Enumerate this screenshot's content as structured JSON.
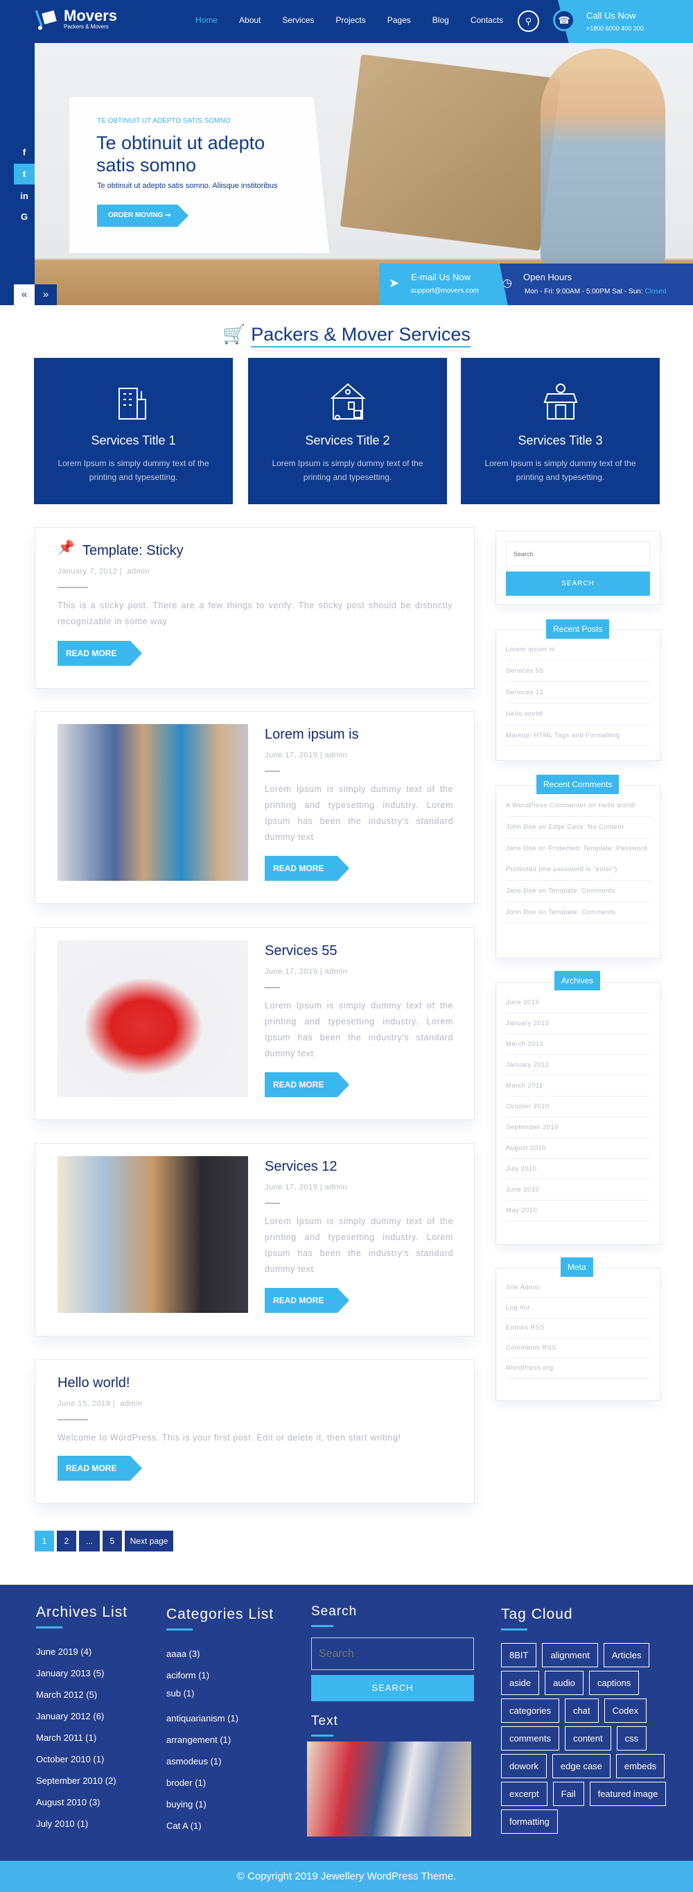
{
  "colors": {
    "navy": "#0d3a8c",
    "cyan": "#3bb7ee",
    "footer": "#233e8c"
  },
  "header": {
    "logo_title": "Movers",
    "logo_subtitle": "Packers & Movers",
    "nav": [
      "Home",
      "About",
      "Services",
      "Projects",
      "Pages",
      "Blog",
      "Contacts"
    ],
    "active_nav": "Home",
    "call_label": "Call Us Now",
    "call_number": "+1800 6000 400 200",
    "icons": [
      "search-icon",
      "phone-icon"
    ]
  },
  "hero": {
    "kicker": "TE OBTINUIT UT ADEPTO SATIS SOMNO",
    "title": "Te obtinuit ut adepto satis somno",
    "subtitle": "Te obtinuit ut adepto satis somno. Aliisque institoribus",
    "button": "ORDER MOVING ➞",
    "social": [
      "facebook-icon",
      "twitter-icon",
      "linkedin-icon",
      "google-icon"
    ],
    "email_label": "E-mail Us Now",
    "email": "support@movers.com",
    "hours_label": "Open Hours",
    "hours": "Mon - Fri: 9:00AM - 5:00PM Sat - Sun: ",
    "hours_closed": "Closed"
  },
  "services": {
    "title": "Packers & Mover Services",
    "items": [
      {
        "title": "Services Title 1",
        "text": "Lorem Ipsum is simply dummy text of the  printing and typesetting.",
        "icon": "building-icon"
      },
      {
        "title": "Services Title 2",
        "text": "Lorem Ipsum is simply dummy text of the  printing and typesetting.",
        "icon": "house-truck-icon"
      },
      {
        "title": "Services Title 3",
        "text": "Lorem Ipsum is simply dummy text of the  printing and typesetting.",
        "icon": "shop-icon"
      }
    ]
  },
  "posts": [
    {
      "title": "Template: Sticky",
      "date": "January 7, 2012",
      "author": "admin",
      "text": "This is a sticky post. There are a few things to verify: The sticky post should be distinctly recognizable in some way",
      "read_more": "READ MORE"
    },
    {
      "title": "Lorem ipsum is",
      "date": "June 17, 2019",
      "author": "admin",
      "text": "Lorem Ipsum is simply dummy text of the printing and typesetting industry. Lorem Ipsum has been the industry's standard dummy text",
      "read_more": "READ MORE"
    },
    {
      "title": "Services 55",
      "date": "June 17, 2019",
      "author": "admin",
      "text": "Lorem Ipsum is simply dummy text of the printing and typesetting industry. Lorem Ipsum has been the industry's standard dummy text",
      "read_more": "READ MORE"
    },
    {
      "title": "Services 12",
      "date": "June 17, 2019",
      "author": "admin",
      "text": "Lorem Ipsum is simply dummy text of the printing and typesetting industry. Lorem Ipsum has been the industry's standard dummy text",
      "read_more": "READ MORE"
    },
    {
      "title": "Hello world!",
      "date": "June 15, 2019",
      "author": "admin",
      "text": "Welcome to WordPress. This is your first post. Edit or delete it, then start writing!",
      "read_more": "READ MORE"
    }
  ],
  "pagination": {
    "pages": [
      "1",
      "2",
      "...",
      "5"
    ],
    "current": "1",
    "next": "Next page"
  },
  "sidebar": {
    "search_placeholder": "Search",
    "search_button": "SEARCH",
    "recent_posts": {
      "title": "Recent Posts",
      "items": [
        "Lorem ipsum is",
        "Services 55",
        "Services 12",
        "Hello world!",
        "Markup: HTML Tags and Formatting"
      ]
    },
    "recent_comments": {
      "title": "Recent Comments",
      "items": [
        "A WordPress Commenter on Hello world!",
        "John Doe on Edge Case: No Content",
        "Jane Doe on Protected: Template: Password Protected (the password is \"enter\")",
        "Jane Doe on Template: Comments",
        "John Doe on Template: Comments"
      ]
    },
    "archives": {
      "title": "Archives",
      "items": [
        "June 2019",
        "January 2013",
        "March 2012",
        "January 2012",
        "March 2011",
        "October 2010",
        "September 2010",
        "August 2010",
        "July 2010",
        "June 2010",
        "May 2010"
      ]
    },
    "meta": {
      "title": "Meta",
      "items": [
        "Site Admin",
        "Log out",
        "Entries RSS",
        "Comments RSS",
        "WordPress.org"
      ]
    }
  },
  "footer": {
    "archives_title": "Archives List",
    "archives": [
      "June 2019 (4)",
      "January 2013 (5)",
      "March 2012 (5)",
      "January 2012 (6)",
      "March 2011 (1)",
      "October 2010 (1)",
      "September 2010 (2)",
      "August 2010 (3)",
      "July 2010 (1)"
    ],
    "categories_title": "Categories List",
    "categories": [
      "aaaa (3)",
      "aciform (1)",
      "sub (1)",
      "antiquarianism (1)",
      "arrangement (1)",
      "asmodeus (1)",
      "broder (1)",
      "buying (1)",
      "Cat A (1)"
    ],
    "search_title": "Search",
    "search_placeholder": "Search",
    "search_button": "SEARCH",
    "text_title": "Text",
    "tag_title": "Tag Cloud",
    "tags": [
      "8BIT",
      "alignment",
      "Articles",
      "aside",
      "audio",
      "captions",
      "categories",
      "chat",
      "Codex",
      "comments",
      "content",
      "css",
      "dowork",
      "edge case",
      "embeds",
      "excerpt",
      "Fail",
      "featured image",
      "formatting"
    ],
    "copyright": "© Copyright 2019 Jewellery WordPress Theme."
  }
}
